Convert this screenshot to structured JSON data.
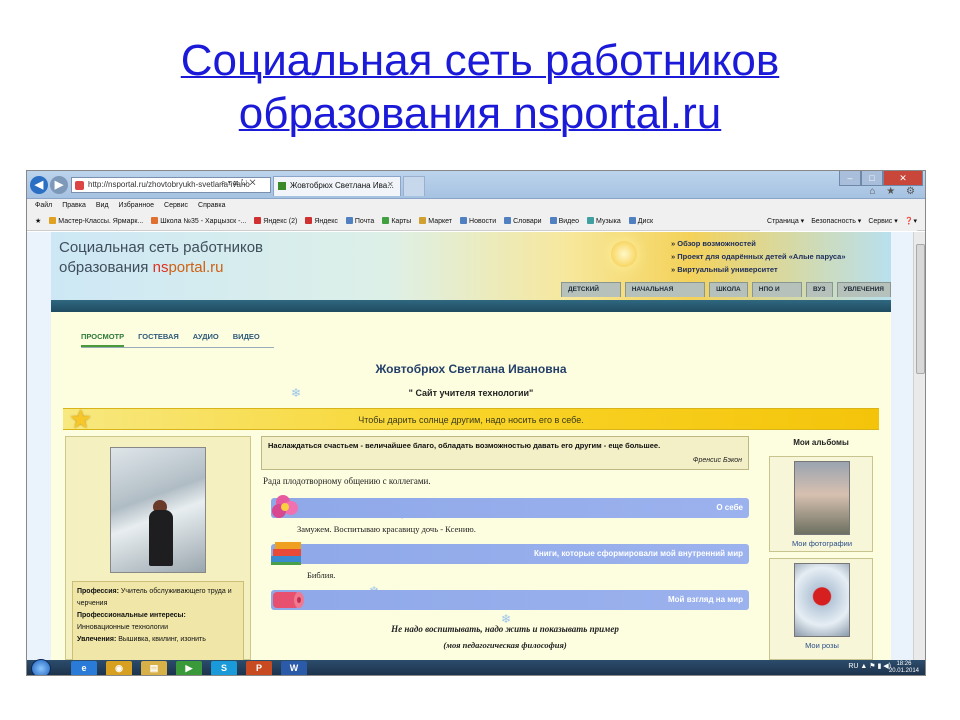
{
  "slide": {
    "title_line1": "Социальная сеть работников",
    "title_line2": "образования nsportal.ru"
  },
  "browser": {
    "address": "http://nsportal.ru/zhovtobryukh-svetlana-ivano",
    "address_tools": "⌕ ▾ ⊠ ↻ ✕",
    "tab_label": "Жовтобрюх Светлана Ива...",
    "tab_close": "✕",
    "window_buttons": {
      "minimize": "–",
      "maximize": "□",
      "close": "✕"
    },
    "toolbar_icons": "⌂ ★ ⚙",
    "menu": [
      "Файл",
      "Правка",
      "Вид",
      "Избранное",
      "Сервис",
      "Справка"
    ],
    "favorites": [
      {
        "label": "Мастер-Классы. Ярмарк...",
        "color": "#e0a020"
      },
      {
        "label": "Школа №35 - Харцызск -...",
        "color": "#e07030"
      },
      {
        "label": "Яндекс (2)",
        "color": "#d03030"
      },
      {
        "label": "Яндекс",
        "color": "#d03030"
      },
      {
        "label": "Почта",
        "color": "#5080c0"
      },
      {
        "label": "Карты",
        "color": "#40a040"
      },
      {
        "label": "Маркет",
        "color": "#d0a030"
      },
      {
        "label": "Новости",
        "color": "#5080c0"
      },
      {
        "label": "Словари",
        "color": "#5080c0"
      },
      {
        "label": "Видео",
        "color": "#5080c0"
      },
      {
        "label": "Музыка",
        "color": "#40a0a0"
      },
      {
        "label": "Диск",
        "color": "#5080c0"
      }
    ],
    "command_bar": [
      "Страница ▾",
      "Безопасность ▾",
      "Сервис ▾",
      "❓▾"
    ]
  },
  "site": {
    "logo_line1": "Социальная сеть работников",
    "logo_line2_prefix": "образования ",
    "logo_ns": "ns",
    "logo_portal": "portal.ru",
    "top_links": [
      "Обзор возможностей",
      "Проект для одарённых детей «Алые паруса»",
      "Виртуальный университет"
    ],
    "tabs": [
      "ДЕТСКИЙ САД",
      "НАЧАЛЬНАЯ ШКОЛА",
      "ШКОЛА",
      "НПО И СПО",
      "ВУЗ",
      "УВЛЕЧЕНИЯ"
    ]
  },
  "profile": {
    "subnav": [
      "ПРОСМОТР",
      "ГОСТЕВАЯ",
      "АУДИО",
      "ВИДЕО"
    ],
    "name": "Жовтобрюх Светлана Ивановна",
    "site_title": "\" Сайт учителя технологии\"",
    "motto": "Чтобы дарить солнце другим, надо носить его в себе.",
    "info": {
      "profession_label": "Профессия:",
      "profession": "Учитель обслуживающего труда и черчения",
      "interests_label": "Профессиональные интересы:",
      "interests": "Инновационные технологии",
      "hobbies_label": "Увлечения:",
      "hobbies": "Вышивка, квилинг, изонить"
    },
    "quote": "Наслаждаться счастьем - величайшее благо, обладать возможностью давать его другим - еще большее.",
    "quote_author": "Френсис Бэкон",
    "greeting": "Рада плодотворному общению с коллегами.",
    "sections": {
      "about": "О себе",
      "about_text": "Замужем. Воспитываю красавицу дочь - Ксению.",
      "books": "Книги, которые сформировали мой внутренний мир",
      "books_text": "Библия.",
      "view": "Мой взгляд на мир",
      "view_text1": "Не надо воспитывать, надо жить и показывать пример",
      "view_text2": "(моя педагогическая философия)"
    },
    "albums_title": "Мои альбомы",
    "albums": [
      "Мои фотографии",
      "Мои розы"
    ]
  },
  "taskbar": {
    "apps": [
      {
        "glyph": "e",
        "color": "#2a7ad8"
      },
      {
        "glyph": "◉",
        "color": "#d8a020"
      },
      {
        "glyph": "▤",
        "color": "#d8b048"
      },
      {
        "glyph": "▶",
        "color": "#3a9a3a"
      },
      {
        "glyph": "S",
        "color": "#1a9ad8"
      },
      {
        "glyph": "P",
        "color": "#c84a20"
      },
      {
        "glyph": "W",
        "color": "#2a5aa8"
      }
    ],
    "language": "RU",
    "tray_icons": "▲ ⚑ ▮ ◀)",
    "time": "18:26",
    "date": "20.01.2014"
  }
}
